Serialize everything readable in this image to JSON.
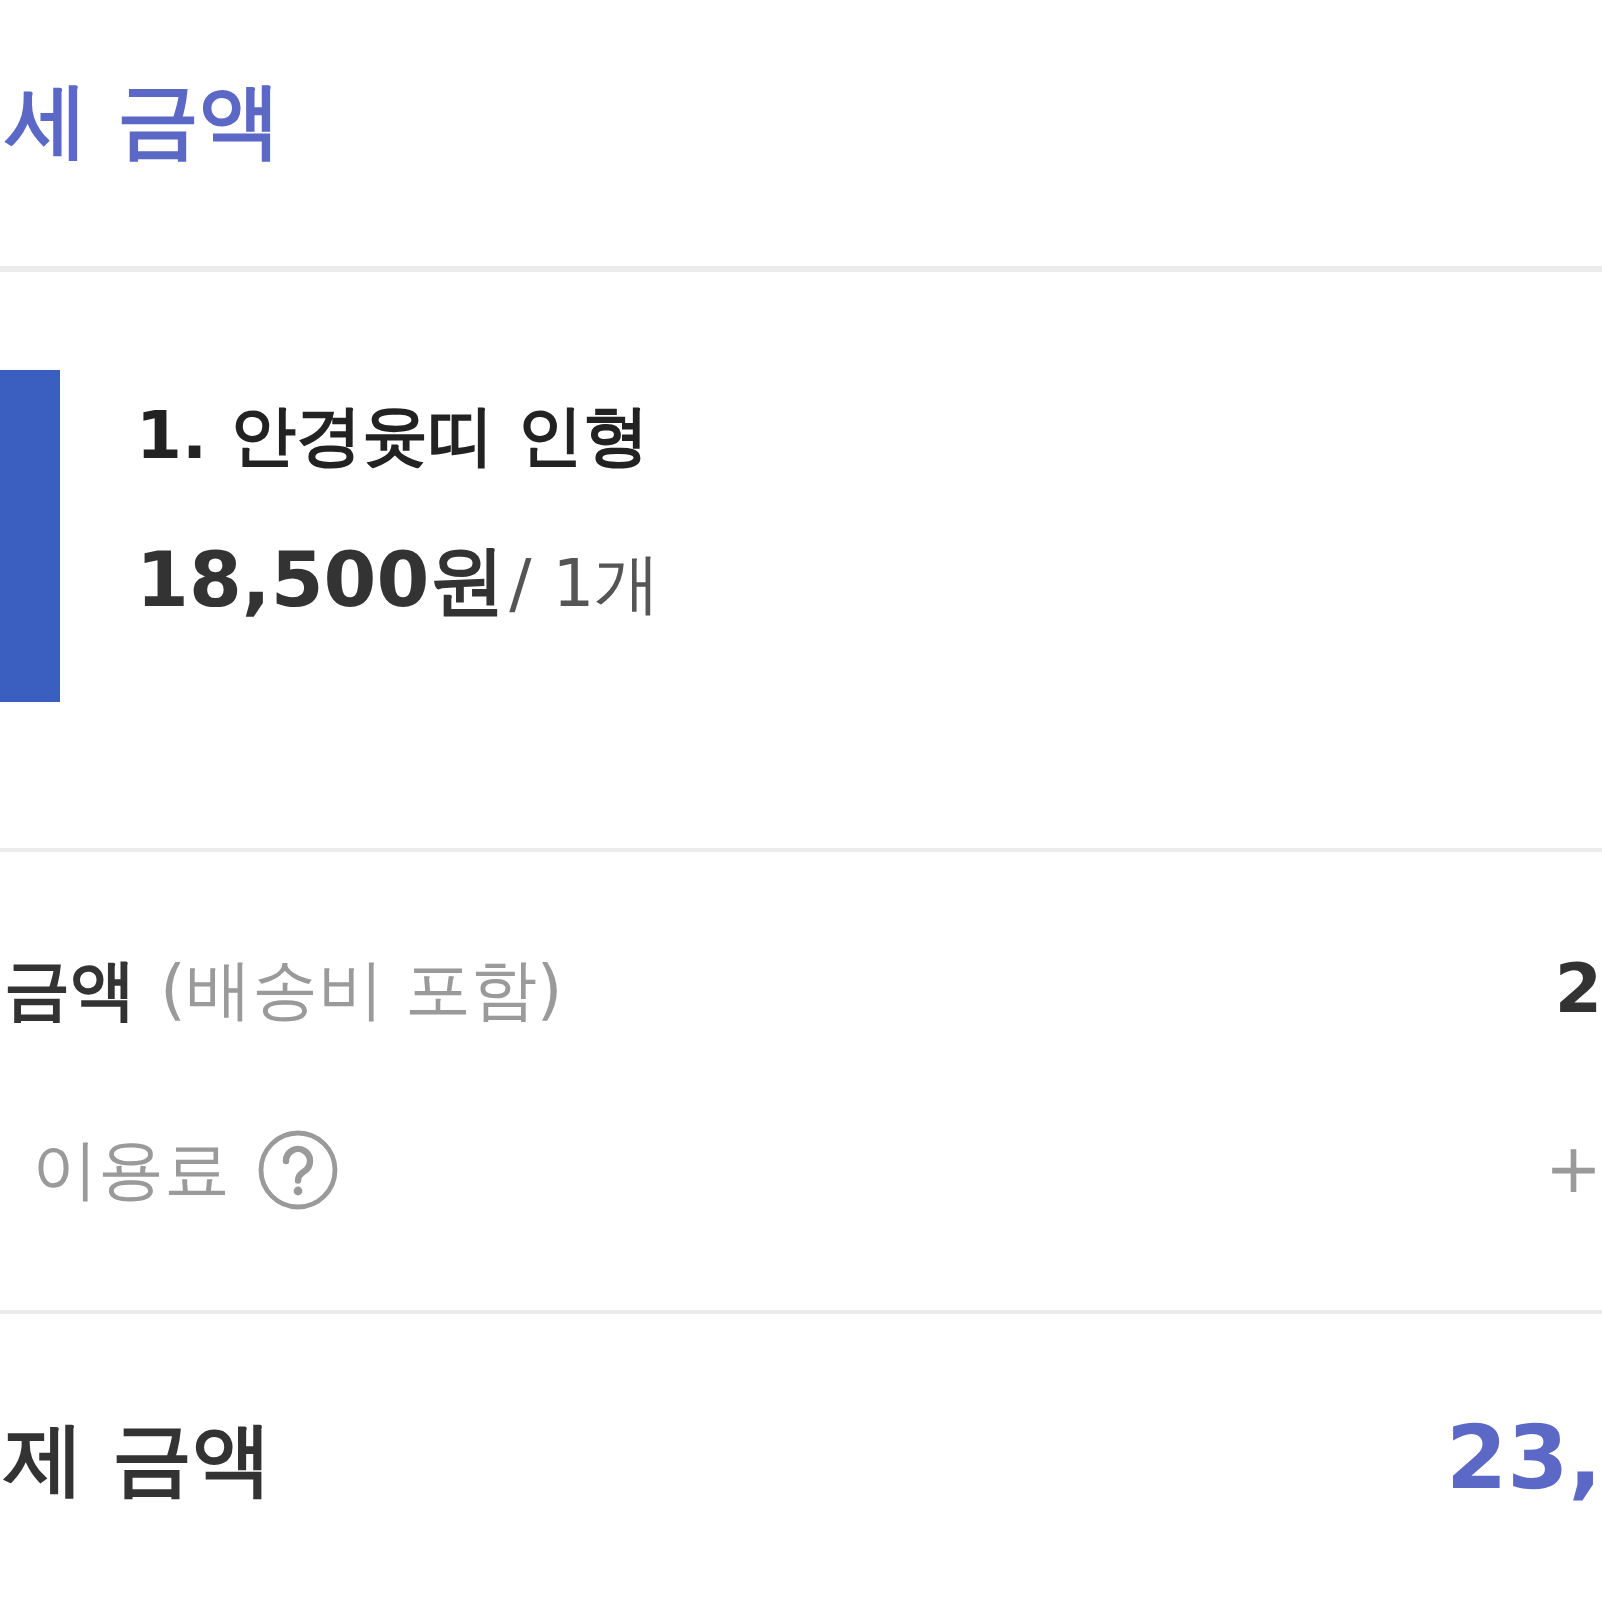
{
  "header": {
    "title": "세 금액"
  },
  "items": [
    {
      "name": "1. 안경윳띠 인형",
      "price": "18,500원",
      "quantity": "/ 1개"
    }
  ],
  "summary_rows": [
    {
      "kind": "amount",
      "label": "금액",
      "note": "(배송비 포함)",
      "value": "2",
      "help": false
    },
    {
      "kind": "fee",
      "label": "이용료",
      "value": "+",
      "help": true
    }
  ],
  "total": {
    "label": "제 금액",
    "value": "23,"
  }
}
